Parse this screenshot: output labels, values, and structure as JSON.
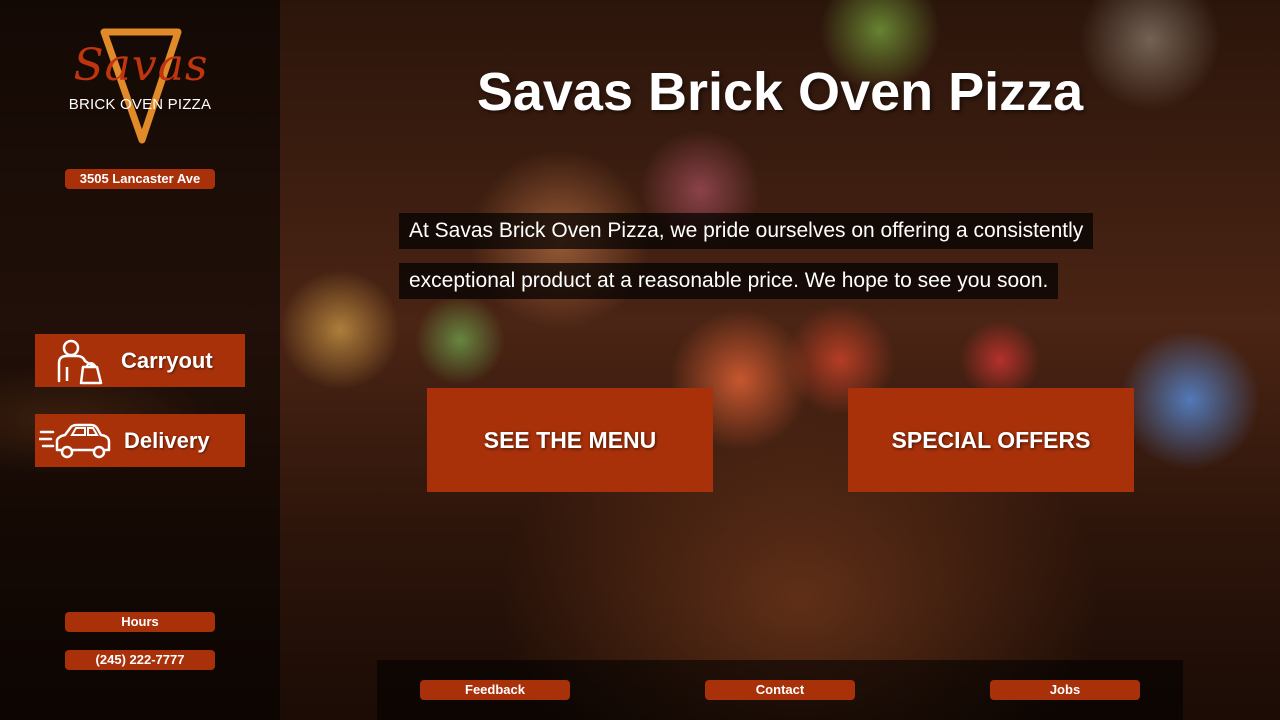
{
  "brand": {
    "logo_script": "Savas",
    "logo_sub": "BRICK OVEN PIZZA",
    "address": "3505 Lancaster Ave"
  },
  "sidebar": {
    "carryout_label": "Carryout",
    "delivery_label": "Delivery",
    "hours_label": "Hours",
    "phone": "(245) 222-7777"
  },
  "main": {
    "title": "Savas Brick Oven Pizza",
    "tagline_line1": "At Savas Brick Oven Pizza, we pride ourselves on offering a consistently",
    "tagline_line2": "exceptional product at a reasonable price. We hope to see you soon.",
    "menu_button": "SEE THE MENU",
    "offers_button": "SPECIAL OFFERS"
  },
  "footer": {
    "feedback": "Feedback",
    "contact": "Contact",
    "jobs": "Jobs"
  },
  "colors": {
    "accent": "#a8310a",
    "logo_red": "#c0350f",
    "logo_orange": "#e08a2a"
  },
  "icons": {
    "carryout": "person-carrying-bag-icon",
    "delivery": "speeding-car-icon",
    "logo_mark": "pizza-slice-icon"
  }
}
